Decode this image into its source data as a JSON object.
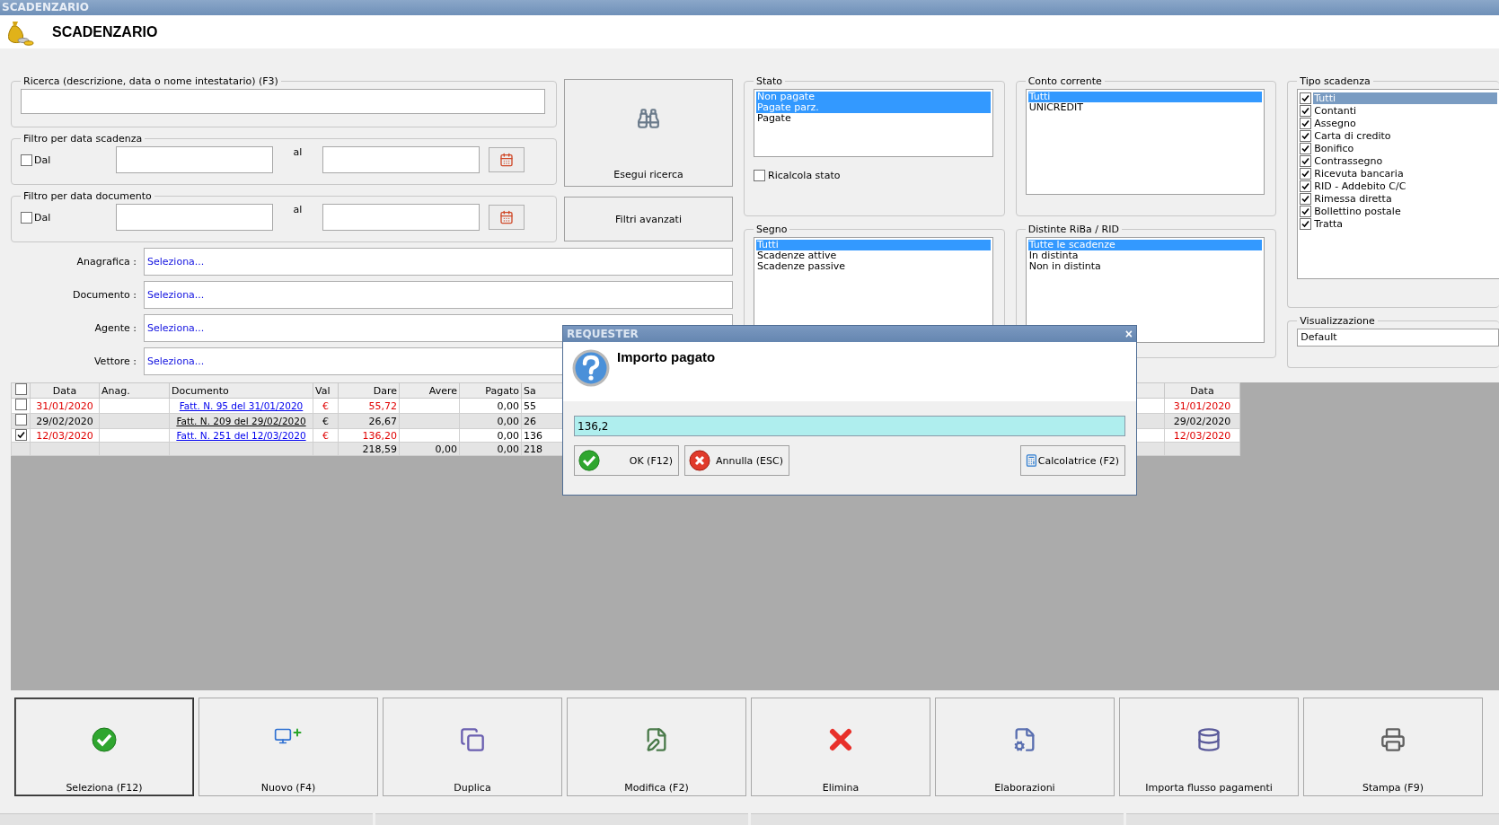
{
  "window": {
    "title": "SCADENZARIO"
  },
  "header": {
    "title": "SCADENZARIO"
  },
  "search": {
    "label": "Ricerca (descrizione, data o nome intestatario) (F3)"
  },
  "date_filters": [
    {
      "label": "Filtro per data scadenza",
      "checkbox_label": "Dal",
      "checked": false,
      "to_label": "al"
    },
    {
      "label": "Filtro per data documento",
      "checkbox_label": "Dal",
      "checked": false,
      "to_label": "al"
    }
  ],
  "side_buttons": [
    {
      "kind": "icon",
      "label": "Esegui ricerca"
    },
    {
      "kind": "plain",
      "label": "Filtri avanzati"
    }
  ],
  "pickers": [
    {
      "label": "Anagrafica :",
      "value": "Seleziona..."
    },
    {
      "label": "Documento :",
      "value": "Seleziona..."
    },
    {
      "label": "Agente :",
      "value": "Seleziona..."
    },
    {
      "label": "Vettore :",
      "value": "Seleziona..."
    }
  ],
  "stato": {
    "title": "Stato",
    "items": [
      {
        "label": "Non pagate",
        "selected": true
      },
      {
        "label": "Pagate parz.",
        "selected": true
      },
      {
        "label": "Pagate",
        "selected": false
      }
    ],
    "recalc": {
      "label": "Ricalcola stato",
      "checked": false
    }
  },
  "conto_corrente": {
    "title": "Conto corrente",
    "items": [
      {
        "label": "Tutti",
        "selected": true
      },
      {
        "label": "UNICREDIT",
        "selected": false
      }
    ]
  },
  "segno": {
    "title": "Segno",
    "items": [
      {
        "label": "Tutti",
        "selected": true
      },
      {
        "label": "Scadenze attive",
        "selected": false
      },
      {
        "label": "Scadenze passive",
        "selected": false
      }
    ]
  },
  "distinte": {
    "title": "Distinte RiBa / RID",
    "items": [
      {
        "label": "Tutte le scadenze",
        "selected": true
      },
      {
        "label": "In distinta",
        "selected": false
      },
      {
        "label": "Non in distinta",
        "selected": false
      }
    ]
  },
  "tipo_scadenza": {
    "title": "Tipo scadenza",
    "items": [
      {
        "label": "Tutti",
        "checked": true,
        "selected": true
      },
      {
        "label": "Contanti",
        "checked": true,
        "selected": false
      },
      {
        "label": "Assegno",
        "checked": true,
        "selected": false
      },
      {
        "label": "Carta di credito",
        "checked": true,
        "selected": false
      },
      {
        "label": "Bonifico",
        "checked": true,
        "selected": false
      },
      {
        "label": "Contrassegno",
        "checked": true,
        "selected": false
      },
      {
        "label": "Ricevuta bancaria",
        "checked": true,
        "selected": false
      },
      {
        "label": "RID - Addebito C/C",
        "checked": true,
        "selected": false
      },
      {
        "label": "Rimessa diretta",
        "checked": true,
        "selected": false
      },
      {
        "label": "Bollettino postale",
        "checked": true,
        "selected": false
      },
      {
        "label": "Tratta",
        "checked": true,
        "selected": false
      }
    ]
  },
  "visualizzazione": {
    "title": "Visualizzazione",
    "value": "Default"
  },
  "table": {
    "header_checked": false,
    "columns": [
      "Data",
      "Anag.",
      "Documento",
      "Val",
      "Dare",
      "Avere",
      "Pagato",
      "Sa",
      "Data"
    ],
    "rows": [
      {
        "checked": false,
        "overdue": true,
        "cells": [
          "31/01/2020",
          "",
          "Fatt. N. 95 del 31/01/2020",
          "€",
          "55,72",
          "",
          "0,00",
          "55",
          "31/01/2020"
        ]
      },
      {
        "checked": false,
        "overdue": false,
        "cells": [
          "29/02/2020",
          "",
          "Fatt. N. 209 del 29/02/2020",
          "€",
          "26,67",
          "",
          "0,00",
          "26",
          "29/02/2020"
        ]
      },
      {
        "checked": true,
        "overdue": true,
        "cells": [
          "12/03/2020",
          "",
          "Fatt. N. 251 del 12/03/2020",
          "€",
          "136,20",
          "",
          "0,00",
          "136",
          "12/03/2020"
        ]
      }
    ],
    "totals": {
      "dare": "218,59",
      "avere": "0,00",
      "pagato": "0,00",
      "sa": "218"
    }
  },
  "toolbar": [
    {
      "kind": "check",
      "label": "Seleziona (F12)",
      "selected": true
    },
    {
      "kind": "new",
      "label": "Nuovo (F4)",
      "selected": false
    },
    {
      "kind": "copy",
      "label": "Duplica",
      "selected": false
    },
    {
      "kind": "edit",
      "label": "Modifica (F2)",
      "selected": false
    },
    {
      "kind": "delete",
      "label": "Elimina",
      "selected": false
    },
    {
      "kind": "gear",
      "label": "Elaborazioni",
      "selected": false
    },
    {
      "kind": "import",
      "label": "Importa flusso pagamenti",
      "selected": false
    },
    {
      "kind": "print",
      "label": "Stampa (F9)",
      "selected": false
    }
  ],
  "dialog": {
    "title": "REQUESTER",
    "close": "×",
    "message": "Importo pagato",
    "value": "136,2",
    "buttons": [
      {
        "kind": "ok",
        "label": "OK (F12)"
      },
      {
        "kind": "cancel",
        "label": "Annulla (ESC)"
      },
      {
        "kind": "calc",
        "label": "Calcolatrice (F2)"
      }
    ]
  }
}
